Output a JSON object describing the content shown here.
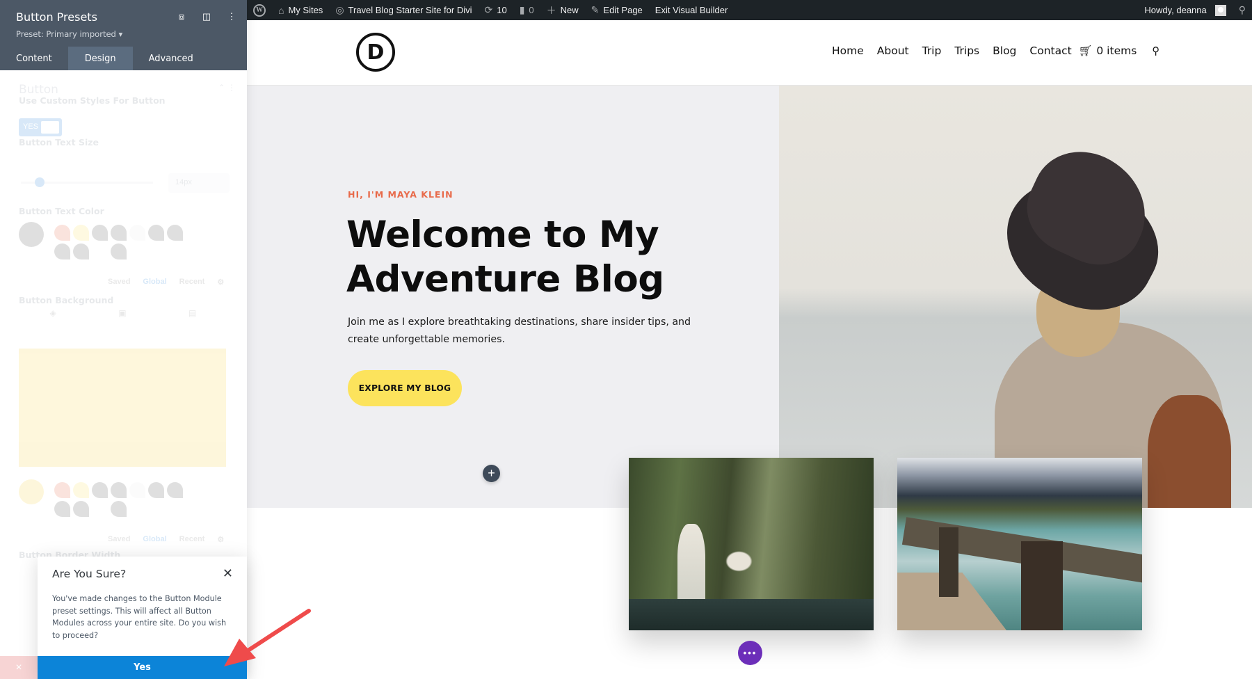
{
  "admin_bar": {
    "wp_logo": "W",
    "my_sites": "My Sites",
    "site_name": "Travel Blog Starter Site for Divi",
    "updates_count": "10",
    "comments_count": "0",
    "new_label": "New",
    "edit_page": "Edit Page",
    "exit_builder": "Exit Visual Builder",
    "howdy": "Howdy, deanna"
  },
  "site": {
    "logo_letter": "D",
    "nav": [
      "Home",
      "About",
      "Trip",
      "Trips",
      "Blog",
      "Contact"
    ],
    "cart_label": "0 items"
  },
  "hero": {
    "eyebrow": "HI, I'M MAYA KLEIN",
    "headline": "Welcome to My Adventure Blog",
    "subtext": "Join me as I explore breathtaking destinations, share insider tips, and create unforgettable memories.",
    "cta": "EXPLORE MY BLOG"
  },
  "builder": {
    "add_row": "+",
    "more": "•••"
  },
  "panel": {
    "title": "Button Presets",
    "preset": "Preset: Primary imported ▾",
    "tabs": [
      "Content",
      "Design",
      "Advanced"
    ],
    "active_tab": "Design",
    "section": "Button",
    "options": {
      "custom_styles_label": "Use Custom Styles For Button",
      "custom_styles_value": "YES",
      "text_size_label": "Button Text Size",
      "text_size_value": "14px",
      "text_color_label": "Button Text Color",
      "background_label": "Button Background",
      "border_width_label": "Button Border Width",
      "palette_tabs": [
        "Saved",
        "Global",
        "Recent"
      ]
    },
    "background_color": "#f7d23c"
  },
  "modal": {
    "title": "Are You Sure?",
    "message": "You've made changes to the Button Module preset settings. This will affect all Button Modules across your entire site. Do you wish to proceed?",
    "confirm": "Yes",
    "cancel_icon": "×"
  },
  "colors": {
    "admin_bar": "#1d2327",
    "panel_header": "#4c5866",
    "confirm_button": "#0c84d8",
    "cta_yellow": "#fce35c",
    "eyebrow_orange": "#e86a4a",
    "more_button_purple": "#6c2eb9",
    "arrow_red": "#ef4b4b"
  }
}
